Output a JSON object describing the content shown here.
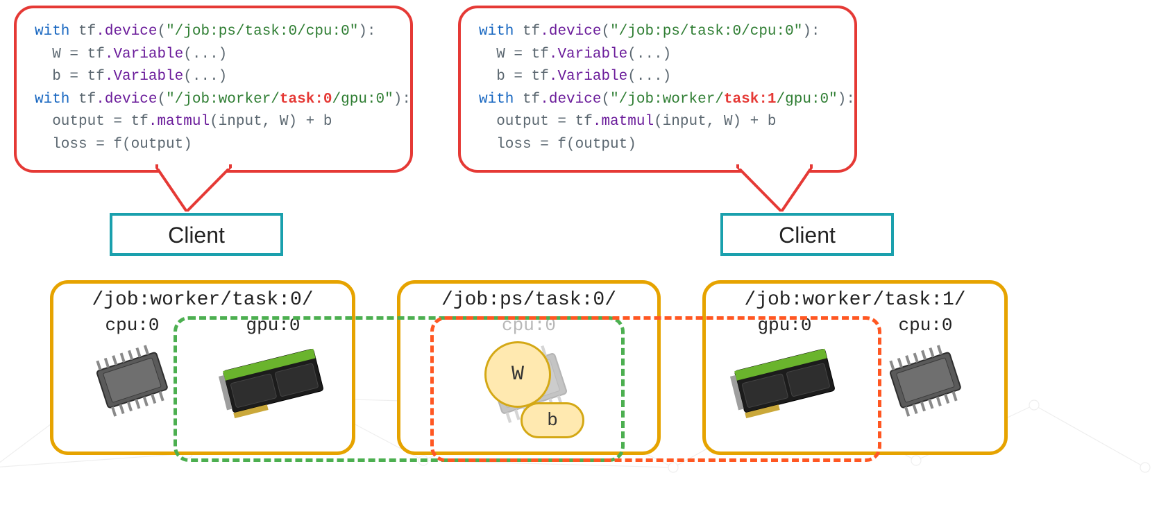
{
  "bubbles": {
    "left": {
      "line1_device": "\"/job:ps/task:0/cpu:0\"",
      "line4_device_prefix": "\"/job:worker/",
      "line4_device_task": "task:0",
      "line4_device_suffix": "/gpu:0\""
    },
    "right": {
      "line1_device": "\"/job:ps/task:0/cpu:0\"",
      "line4_device_prefix": "\"/job:worker/",
      "line4_device_task": "task:1",
      "line4_device_suffix": "/gpu:0\""
    },
    "shared": {
      "kw_with": "with",
      "tf": "tf",
      "dot_device": ".device",
      "dot_variable": ".Variable",
      "dot_matmul": ".matmul",
      "assign_W": "W = ",
      "assign_b": "b = ",
      "ellipsis_args": "(...)",
      "colon_close": "):",
      "line5": "output = ",
      "line5_args": "(input, W) + b",
      "line6": "loss = f(output)"
    }
  },
  "client_label": "Client",
  "jobs": {
    "worker0": {
      "title": "/job:worker/task:0/",
      "cpu": "cpu:0",
      "gpu": "gpu:0"
    },
    "ps0": {
      "title": "/job:ps/task:0/",
      "cpu": "cpu:0"
    },
    "worker1": {
      "title": "/job:worker/task:1/",
      "cpu": "cpu:0",
      "gpu": "gpu:0"
    }
  },
  "vars": {
    "W": "W",
    "b": "b"
  }
}
